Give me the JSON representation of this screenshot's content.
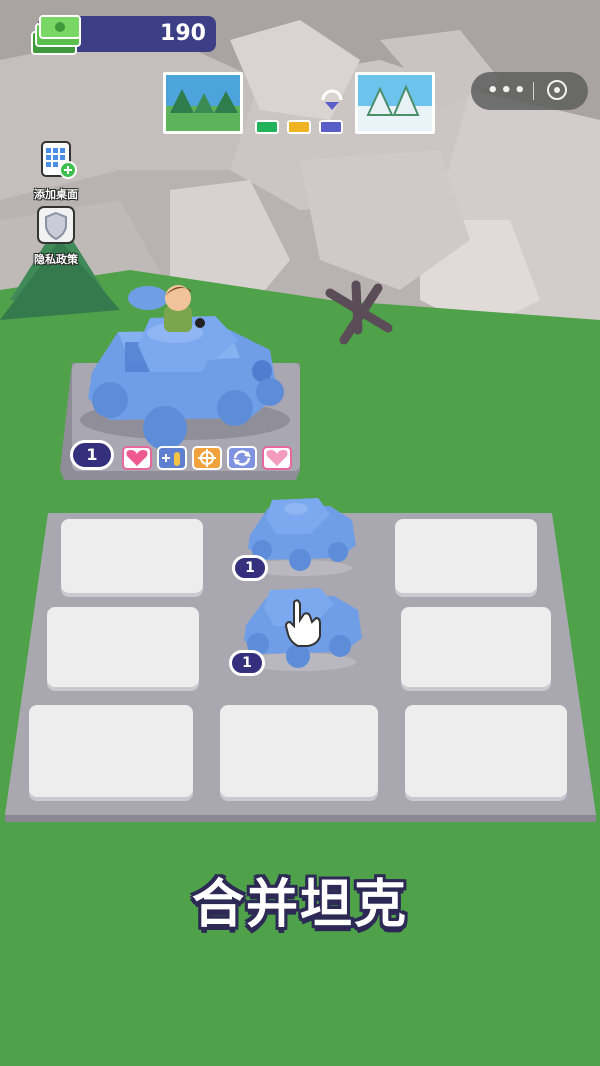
{
  "hud": {
    "coins": "190",
    "level_progress": {
      "stages_total": 3,
      "current_stage": 3
    }
  },
  "capsule": {
    "more_glyph": "•••",
    "close_icon": "target-icon"
  },
  "side_buttons": [
    {
      "label": "添加桌面",
      "icon": "add-desktop-icon"
    },
    {
      "label": "隐私政策",
      "icon": "shield-icon"
    }
  ],
  "showcase": {
    "tank_level": "1",
    "buffs": [
      "heart-icon",
      "ammo-plus-icon",
      "crosshair-icon",
      "reload-icon",
      "heart-icon"
    ]
  },
  "grid": {
    "rows": 3,
    "cols": 3,
    "tanks": [
      {
        "row": 0,
        "col": 1,
        "level": "1"
      },
      {
        "row": 1,
        "col": 1,
        "level": "1"
      }
    ]
  },
  "footer": {
    "title": "合并坦克"
  },
  "colors": {
    "grass": "#4fa24a",
    "rock": "#b9b3b1",
    "tank": "#6f9ee6",
    "badge": "#34307e",
    "coin_bar": "#3c3f86"
  }
}
